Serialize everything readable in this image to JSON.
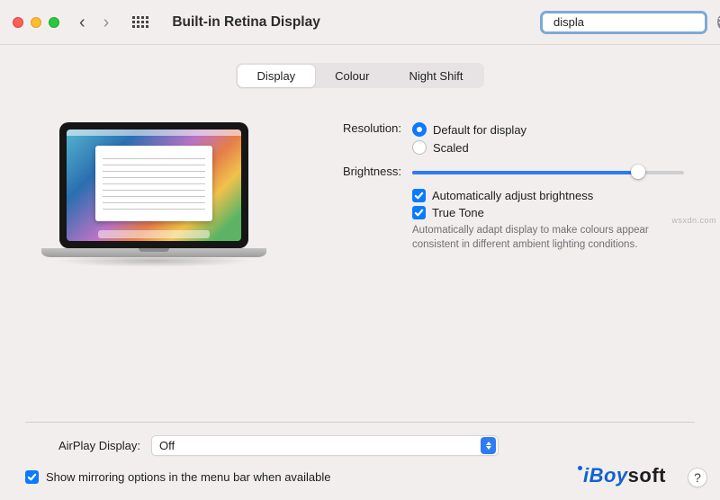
{
  "titlebar": {
    "title": "Built-in Retina Display"
  },
  "search": {
    "value": "displa"
  },
  "tabs": {
    "display": "Display",
    "colour": "Colour",
    "night_shift": "Night Shift"
  },
  "settings": {
    "resolution_label": "Resolution:",
    "res_default": "Default for display",
    "res_scaled": "Scaled",
    "brightness_label": "Brightness:",
    "brightness_value": 83,
    "auto_brightness": "Automatically adjust brightness",
    "true_tone": "True Tone",
    "true_tone_note": "Automatically adapt display to make colours appear consistent in different ambient lighting conditions."
  },
  "airplay": {
    "label": "AirPlay Display:",
    "selected": "Off"
  },
  "mirror": {
    "label": "Show mirroring options in the menu bar when available"
  },
  "brand": {
    "part1": "iBoy",
    "part2": "soft"
  },
  "help": "?",
  "watermark": "wsxdn.com"
}
